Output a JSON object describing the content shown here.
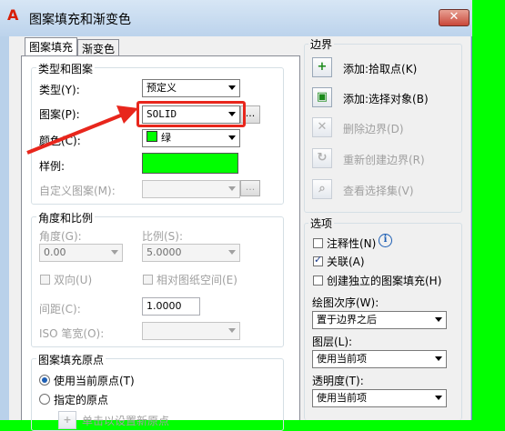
{
  "window": {
    "title": "图案填充和渐变色",
    "close_label": "✕",
    "logo_letter": "A"
  },
  "tabs": [
    {
      "label": "图案填充"
    },
    {
      "label": "渐变色"
    }
  ],
  "type_pattern": {
    "group_label": "类型和图案",
    "type_label": "类型(Y):",
    "type_value": "预定义",
    "pattern_label": "图案(P):",
    "pattern_value": "SOLID",
    "pattern_browse": "...",
    "color_label": "颜色(C):",
    "color_value": "绿",
    "swatch_label": "样例:",
    "swatch_color": "#00ff00",
    "custom_label": "自定义图案(M):",
    "custom_value": "",
    "custom_browse": "..."
  },
  "angle_scale": {
    "group_label": "角度和比例",
    "angle_label": "角度(G):",
    "angle_value": "0.00",
    "scale_label": "比例(S):",
    "scale_value": "5.0000",
    "double_label": "双向(U)",
    "relative_label": "相对图纸空间(E)",
    "spacing_label": "间距(C):",
    "spacing_value": "1.0000",
    "iso_label": "ISO 笔宽(O):",
    "iso_value": ""
  },
  "origin": {
    "group_label": "图案填充原点",
    "use_current_label": "使用当前原点(T)",
    "specified_label": "指定的原点",
    "click_set_label": "单击以设置新原点"
  },
  "boundary": {
    "group_label": "边界",
    "add_pick_label": "添加:拾取点(K)",
    "add_select_label": "添加:选择对象(B)",
    "remove_label": "删除边界(D)",
    "recreate_label": "重新创建边界(R)",
    "view_label": "查看选择集(V)"
  },
  "options": {
    "group_label": "选项",
    "annotative_label": "注释性(N)",
    "associative_label": "关联(A)",
    "associative_checked": true,
    "separate_label": "创建独立的图案填充(H)",
    "draw_order_label": "绘图次序(W):",
    "draw_order_value": "置于边界之后",
    "layer_label": "图层(L):",
    "layer_value": "使用当前项",
    "transparency_label": "透明度(T):",
    "transparency_value": "使用当前项"
  },
  "annotation": {
    "color": "#e8261c"
  }
}
